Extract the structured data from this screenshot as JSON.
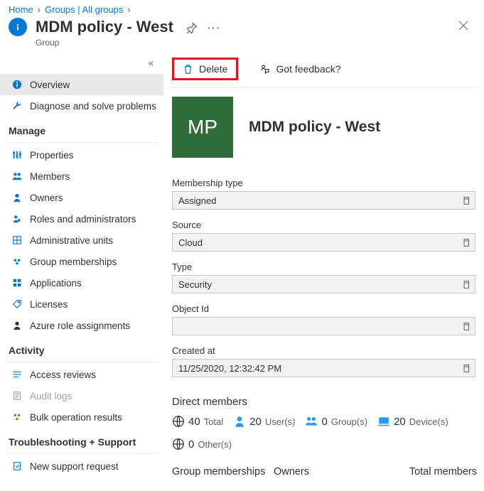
{
  "breadcrumb": {
    "home": "Home",
    "groups": "Groups | All groups"
  },
  "header": {
    "title": "MDM policy - West",
    "subtitle": "Group"
  },
  "commands": {
    "delete": "Delete",
    "feedback": "Got feedback?"
  },
  "sidebar": {
    "overview": "Overview",
    "diagnose": "Diagnose and solve problems",
    "manage_header": "Manage",
    "properties": "Properties",
    "members": "Members",
    "owners": "Owners",
    "roles": "Roles and administrators",
    "admin_units": "Administrative units",
    "group_memberships": "Group memberships",
    "applications": "Applications",
    "licenses": "Licenses",
    "azure_roles": "Azure role assignments",
    "activity_header": "Activity",
    "access_reviews": "Access reviews",
    "audit_logs": "Audit logs",
    "bulk_results": "Bulk operation results",
    "troubleshoot_header": "Troubleshooting + Support",
    "new_support": "New support request"
  },
  "hero": {
    "tile_initials": "MP",
    "name": "MDM policy - West"
  },
  "fields": {
    "membership_type": {
      "label": "Membership type",
      "value": "Assigned"
    },
    "source": {
      "label": "Source",
      "value": "Cloud"
    },
    "type": {
      "label": "Type",
      "value": "Security"
    },
    "object_id": {
      "label": "Object Id",
      "value": ""
    },
    "created_at": {
      "label": "Created at",
      "value": "11/25/2020, 12:32:42 PM"
    }
  },
  "direct_members": {
    "title": "Direct members",
    "total": {
      "count": "40",
      "label": "Total"
    },
    "users": {
      "count": "20",
      "label": "User(s)"
    },
    "groups": {
      "count": "0",
      "label": "Group(s)"
    },
    "devices": {
      "count": "20",
      "label": "Device(s)"
    },
    "others": {
      "count": "0",
      "label": "Other(s)"
    }
  },
  "bottom": {
    "group_memberships": "Group memberships",
    "owners": "Owners",
    "total_members": "Total members"
  }
}
